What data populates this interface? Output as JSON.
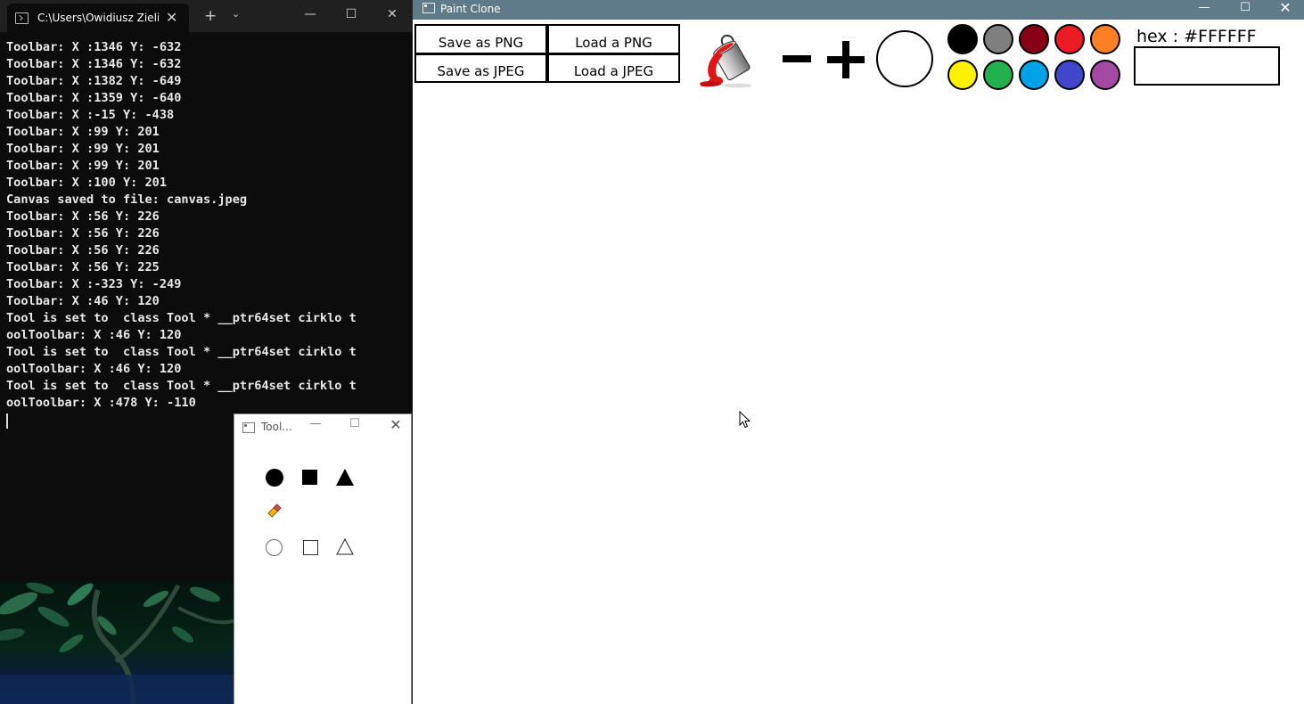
{
  "terminal": {
    "tab_title": "C:\\Users\\Owidiusz Zielir",
    "tab_close": "✕",
    "new_tab": "+",
    "dropdown": "⌄",
    "min": "—",
    "max": "☐",
    "close": "✕",
    "lines": [
      "Toolbar: X :1346 Y: -632",
      "Toolbar: X :1346 Y: -632",
      "Toolbar: X :1382 Y: -649",
      "Toolbar: X :1359 Y: -640",
      "Toolbar: X :-15 Y: -438",
      "Toolbar: X :99 Y: 201",
      "Toolbar: X :99 Y: 201",
      "Toolbar: X :99 Y: 201",
      "Toolbar: X :100 Y: 201",
      "Canvas saved to file: canvas.jpeg",
      "Toolbar: X :56 Y: 226",
      "Toolbar: X :56 Y: 226",
      "Toolbar: X :56 Y: 226",
      "Toolbar: X :56 Y: 225",
      "Toolbar: X :-323 Y: -249",
      "Toolbar: X :46 Y: 120",
      "Tool is set to  class Tool * __ptr64set cirklo t",
      "oolToolbar: X :46 Y: 120",
      "Tool is set to  class Tool * __ptr64set cirklo t",
      "oolToolbar: X :46 Y: 120",
      "Tool is set to  class Tool * __ptr64set cirklo t",
      "oolToolbar: X :478 Y: -110"
    ]
  },
  "toolbar_window": {
    "title": "Tool...",
    "min": "—",
    "max": "☐",
    "close": "✕",
    "tools": [
      "filled-circle",
      "filled-square",
      "filled-triangle",
      "eraser",
      "outline-circle",
      "outline-square",
      "outline-triangle"
    ]
  },
  "paint": {
    "title": "Paint Clone",
    "min": "—",
    "max": "☐",
    "close": "✕",
    "buttons": {
      "save_png": "Save as PNG",
      "load_png": "Load a PNG",
      "save_jpeg": "Save as JPEG",
      "load_jpeg": "Load a JPEG"
    },
    "hex_label": "hex : #FFFFFF",
    "hex_value": "",
    "palette": [
      {
        "name": "black",
        "color": "#000000"
      },
      {
        "name": "gray",
        "color": "#7f7f7f"
      },
      {
        "name": "dark-red",
        "color": "#880015"
      },
      {
        "name": "red",
        "color": "#ed1c24"
      },
      {
        "name": "orange",
        "color": "#ff7f27"
      },
      {
        "name": "yellow",
        "color": "#fff200"
      },
      {
        "name": "green",
        "color": "#22b14c"
      },
      {
        "name": "blue",
        "color": "#00a2e8"
      },
      {
        "name": "indigo",
        "color": "#3f48cc"
      },
      {
        "name": "purple",
        "color": "#a349a4"
      }
    ],
    "brush_color": "#FFFFFF"
  }
}
